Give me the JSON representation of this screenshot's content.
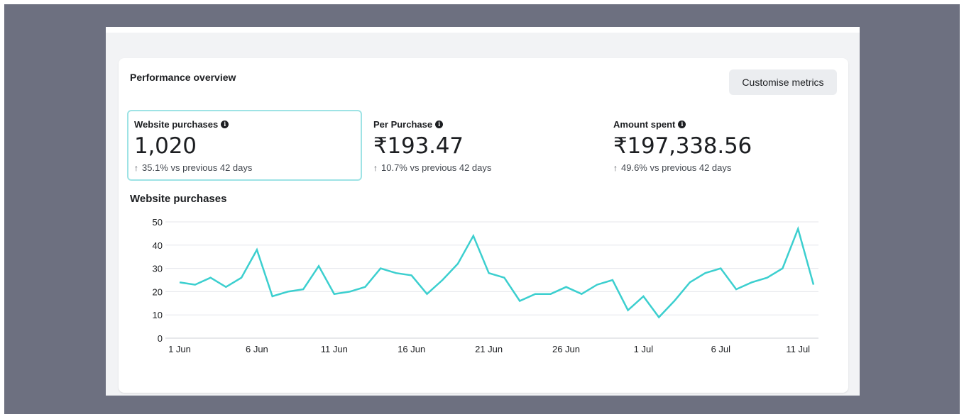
{
  "card": {
    "title": "Performance overview",
    "customise_label": "Customise metrics"
  },
  "metrics": [
    {
      "label": "Website purchases",
      "value": "1,020",
      "change": "35.1% vs previous 42 days",
      "selected": true
    },
    {
      "label": "Per Purchase",
      "value": "₹193.47",
      "change": "10.7% vs previous 42 days",
      "selected": false
    },
    {
      "label": "Amount spent",
      "value": "₹197,338.56",
      "change": "49.6% vs previous 42 days",
      "selected": false
    }
  ],
  "chart_title": "Website purchases",
  "chart_data": {
    "type": "line",
    "ylim": [
      0,
      50
    ],
    "y_ticks": [
      0,
      10,
      20,
      30,
      40,
      50
    ],
    "x_tick_labels": [
      "1 Jun",
      "6 Jun",
      "11 Jun",
      "16 Jun",
      "21 Jun",
      "26 Jun",
      "1 Jul",
      "6 Jul",
      "11 Jul"
    ],
    "grid": true,
    "color": "#3ccfcf",
    "series": [
      {
        "x": [
          "1 Jun",
          "2 Jun",
          "3 Jun",
          "4 Jun",
          "5 Jun",
          "6 Jun",
          "7 Jun",
          "8 Jun",
          "9 Jun",
          "10 Jun",
          "11 Jun",
          "12 Jun",
          "13 Jun",
          "14 Jun",
          "15 Jun",
          "16 Jun",
          "17 Jun",
          "18 Jun",
          "19 Jun",
          "20 Jun",
          "21 Jun",
          "22 Jun",
          "23 Jun",
          "24 Jun",
          "25 Jun",
          "26 Jun",
          "27 Jun",
          "28 Jun",
          "29 Jun",
          "30 Jun",
          "1 Jul",
          "2 Jul",
          "3 Jul",
          "4 Jul",
          "5 Jul",
          "6 Jul",
          "7 Jul",
          "8 Jul",
          "9 Jul",
          "10 Jul",
          "11 Jul",
          "12 Jul"
        ],
        "values": [
          24,
          23,
          26,
          22,
          26,
          38,
          18,
          20,
          21,
          31,
          19,
          20,
          22,
          30,
          28,
          27,
          19,
          25,
          32,
          44,
          28,
          26,
          16,
          19,
          19,
          22,
          19,
          23,
          25,
          12,
          18,
          9,
          16,
          24,
          28,
          30,
          21,
          24,
          26,
          30,
          47,
          23
        ]
      }
    ]
  }
}
